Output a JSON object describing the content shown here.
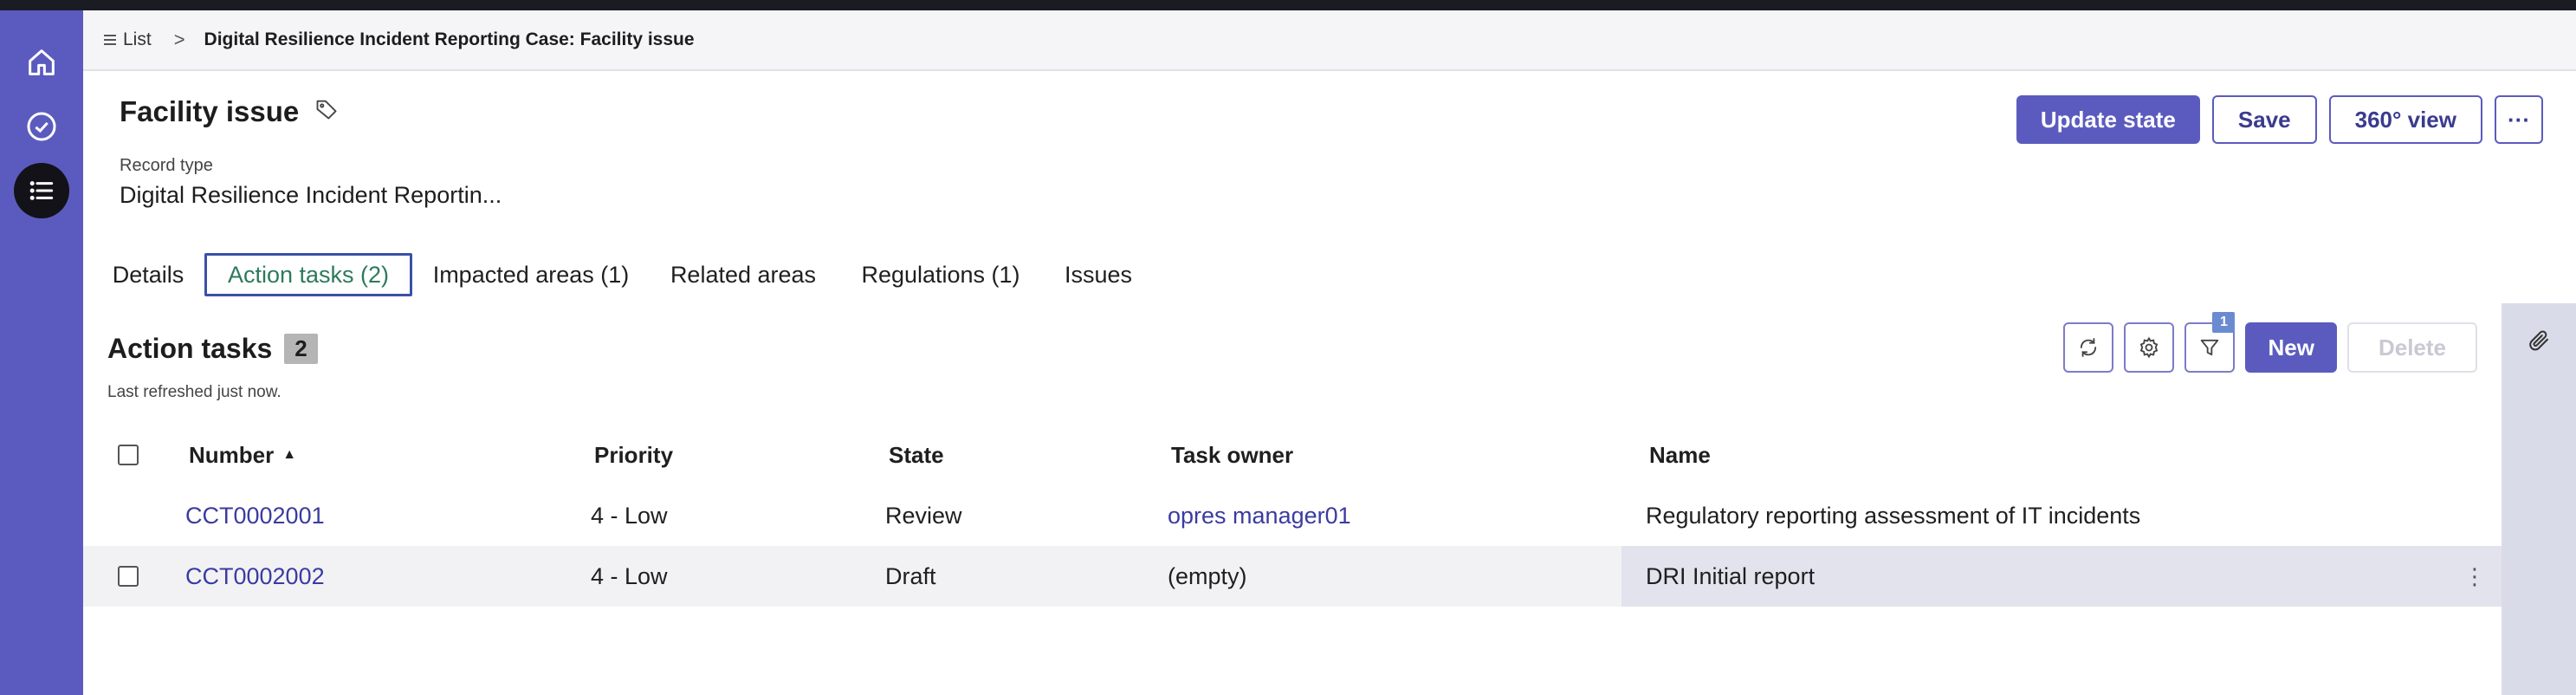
{
  "nav": {
    "items": [
      {
        "icon": "home-icon"
      },
      {
        "icon": "check-circle-icon"
      },
      {
        "icon": "list-icon",
        "active": true
      }
    ]
  },
  "breadcrumb": {
    "list_label": "List",
    "separator": ">",
    "current": "Digital Resilience Incident Reporting Case: Facility issue"
  },
  "record": {
    "title": "Facility issue",
    "record_type_label": "Record type",
    "record_type_value": "Digital Resilience Incident Reportin..."
  },
  "header_actions": {
    "update_state": "Update state",
    "save": "Save",
    "view_360": "360° view",
    "more": "···"
  },
  "tabs": [
    {
      "label": "Details"
    },
    {
      "label": "Action tasks (2)",
      "active": true
    },
    {
      "label": "Impacted areas (1)"
    },
    {
      "label": "Related areas"
    },
    {
      "label": "Regulations (1)"
    },
    {
      "label": "Issues"
    }
  ],
  "list": {
    "title": "Action tasks",
    "count": "2",
    "refreshed": "Last refreshed just now.",
    "filter_count": "1",
    "new_label": "New",
    "delete_label": "Delete",
    "columns": [
      "Number",
      "Priority",
      "State",
      "Task owner",
      "Name"
    ],
    "sort_indicator": "▲",
    "rows": [
      {
        "number": "CCT0002001",
        "priority": "4 - Low",
        "state": "Review",
        "owner": "opres manager01",
        "name": "Regulatory reporting assessment of IT incidents"
      },
      {
        "number": "CCT0002002",
        "priority": "4 - Low",
        "state": "Draft",
        "owner": "(empty)",
        "name": "DRI Initial report"
      }
    ]
  },
  "colors": {
    "accent": "#5b5bbf",
    "rail": "#5b5bbf",
    "link": "#3b3ba0"
  }
}
